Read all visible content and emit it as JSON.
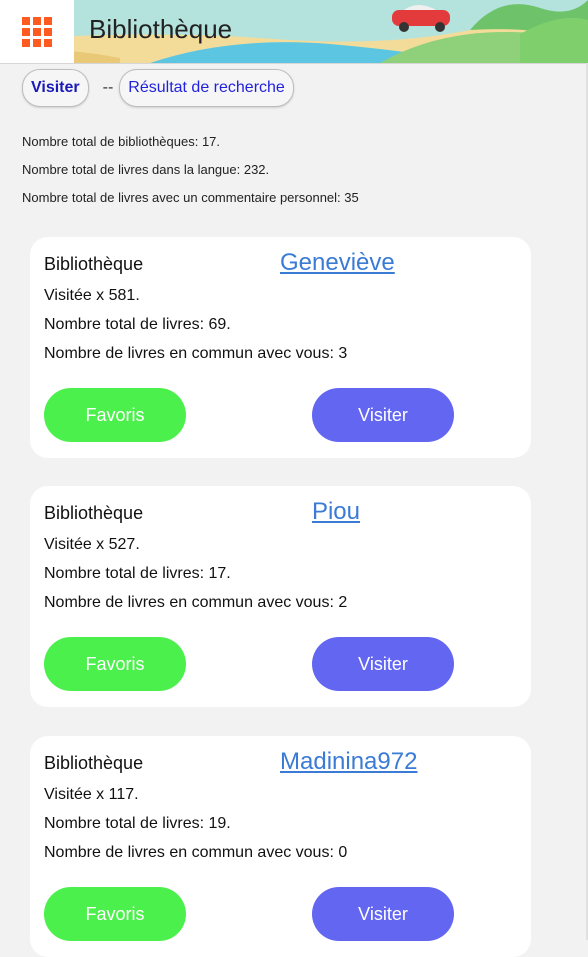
{
  "header": {
    "title": "Bibliothèque",
    "menu_icon": "grid-menu-icon",
    "accent_color": "#ff5a1f"
  },
  "breadcrumb": {
    "current": "Visiter",
    "separator": "--",
    "previous": "Résultat de recherche"
  },
  "stats": {
    "libraries": "Nombre total de bibliothèques: 17.",
    "books_in_language": "Nombre total de livres dans la langue: 232.",
    "books_with_comment": "Nombre total de livres avec un commentaire personnel: 35"
  },
  "cards": [
    {
      "kind": "Bibliothèque",
      "owner": "Geneviève",
      "visits": "Visitée x 581.",
      "total_books": "Nombre total de livres: 69.",
      "common_books": "Nombre de livres en commun avec vous: 3",
      "fav_label": "Favoris",
      "visit_label": "Visiter"
    },
    {
      "kind": "Bibliothèque",
      "owner": "Piou",
      "visits": "Visitée x 527.",
      "total_books": "Nombre total de livres: 17.",
      "common_books": "Nombre de livres en commun avec vous: 2",
      "fav_label": "Favoris",
      "visit_label": "Visiter"
    },
    {
      "kind": "Bibliothèque",
      "owner": "Madinina972",
      "visits": "Visitée x 117.",
      "total_books": "Nombre total de livres: 19.",
      "common_books": "Nombre de livres en commun avec vous: 0",
      "fav_label": "Favoris",
      "visit_label": "Visiter"
    }
  ],
  "colors": {
    "favorite_button": "#4cf04c",
    "visit_button": "#6366f1",
    "link": "#3a7bd5"
  }
}
